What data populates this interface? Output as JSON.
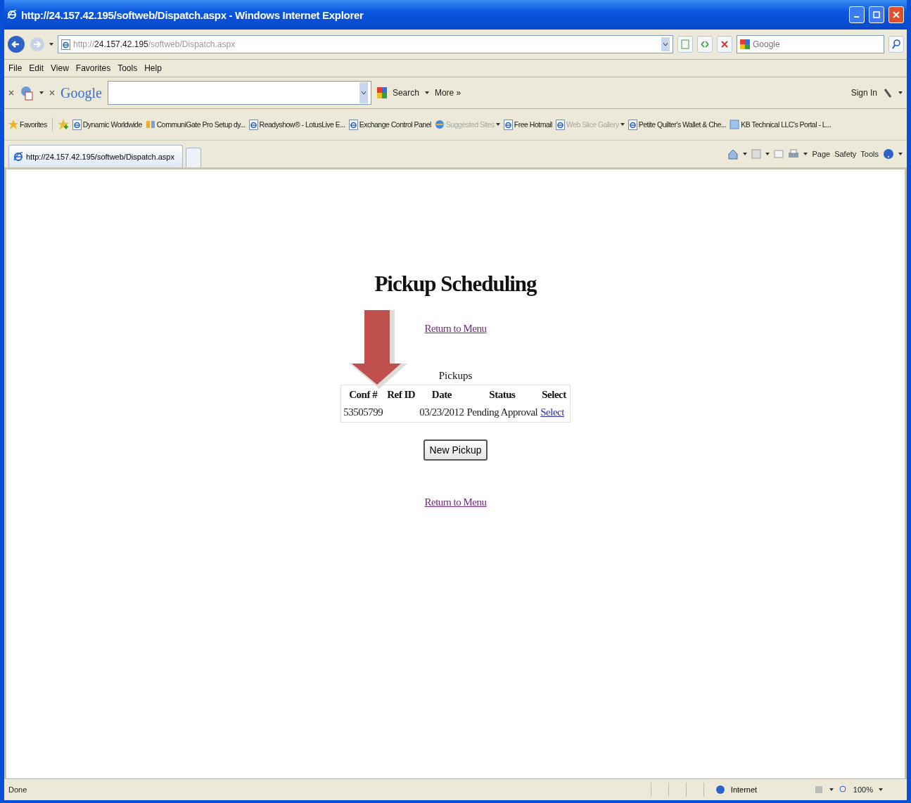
{
  "window": {
    "title": "http://24.157.42.195/softweb/Dispatch.aspx - Windows Internet Explorer"
  },
  "address_bar": {
    "url_prefix": "http://",
    "url_host": "24.157.42.195",
    "url_path": "/softweb/Dispatch.aspx"
  },
  "search_box": {
    "placeholder": "Google"
  },
  "menu": [
    "File",
    "Edit",
    "View",
    "Favorites",
    "Tools",
    "Help"
  ],
  "google_toolbar": {
    "logo": "Google",
    "search_label": "Search",
    "more_label": "More »",
    "sign_in": "Sign In"
  },
  "favorites_bar": {
    "label": "Favorites",
    "items": [
      {
        "kind": "ie",
        "label": "Dynamic Worldwide",
        "dimmed": false,
        "dropdown": false
      },
      {
        "kind": "cg",
        "label": "CommuniGate Pro Setup dy...",
        "dimmed": false,
        "dropdown": false
      },
      {
        "kind": "ie",
        "label": "Readyshow® - LotusLive E...",
        "dimmed": false,
        "dropdown": false
      },
      {
        "kind": "ie",
        "label": "Exchange Control Panel",
        "dimmed": false,
        "dropdown": false
      },
      {
        "kind": "ie-color",
        "label": "Suggested Sites",
        "dimmed": true,
        "dropdown": true
      },
      {
        "kind": "ie",
        "label": "Free Hotmail",
        "dimmed": false,
        "dropdown": false
      },
      {
        "kind": "ie",
        "label": "Web Slice Gallery",
        "dimmed": true,
        "dropdown": true
      },
      {
        "kind": "ie",
        "label": "Petite Quilter's Wallet & Che...",
        "dimmed": false,
        "dropdown": false
      },
      {
        "kind": "kb",
        "label": "KB Technical LLC's Portal - L...",
        "dimmed": false,
        "dropdown": false
      }
    ]
  },
  "tabs": [
    {
      "label": "http://24.157.42.195/softweb/Dispatch.aspx",
      "selected": true
    }
  ],
  "command_bar": [
    "Page",
    "Safety",
    "Tools"
  ],
  "page": {
    "heading": "Pickup Scheduling",
    "top_link": "Return to Menu",
    "caption": "Pickups",
    "columns": [
      "Conf #",
      "Ref ID",
      "Date",
      "Status",
      "Select"
    ],
    "rows": [
      {
        "cells": [
          "53505799",
          "",
          "03/23/2012",
          "Pending Approval"
        ],
        "action": "Select"
      }
    ],
    "button": "New Pickup",
    "bottom_link": "Return to Menu"
  },
  "status_bar": {
    "text": "Done",
    "zone": "Internet",
    "zoom": "100%"
  }
}
